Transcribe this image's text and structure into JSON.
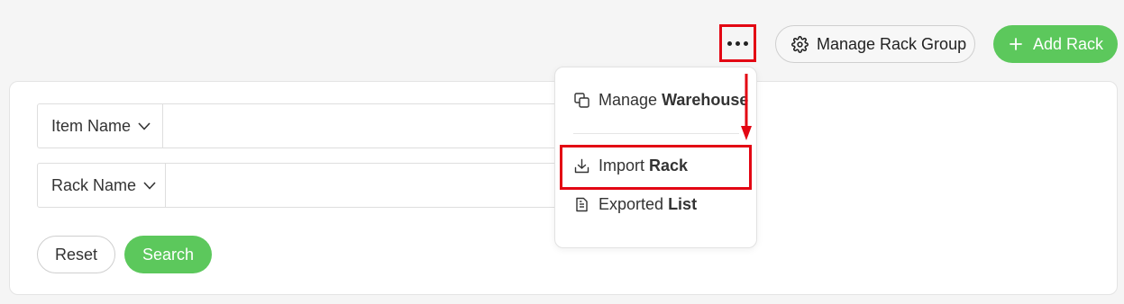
{
  "toolbar": {
    "more_icon": "more-horizontal-icon",
    "manage_rack_group": "Manage Rack Group",
    "manage_rack_group_icon": "gear-icon",
    "add_rack": "Add Rack",
    "add_rack_icon": "plus-icon"
  },
  "filters": [
    {
      "label": "Item Name",
      "icon": "chevron-down-icon",
      "value": ""
    },
    {
      "label": "Rack Name",
      "icon": "chevron-down-icon",
      "value": ""
    }
  ],
  "actions": {
    "reset": "Reset",
    "search": "Search"
  },
  "menu": {
    "items": [
      {
        "prefix": "Manage",
        "bold": "Warehouse",
        "icon": "copy-icon"
      },
      {
        "prefix": "Import",
        "bold": "Rack",
        "icon": "download-icon"
      },
      {
        "prefix": "Exported",
        "bold": "List",
        "icon": "document-icon"
      }
    ]
  },
  "colors": {
    "primary_green": "#5cc85c",
    "annotation_red": "#e30613"
  }
}
